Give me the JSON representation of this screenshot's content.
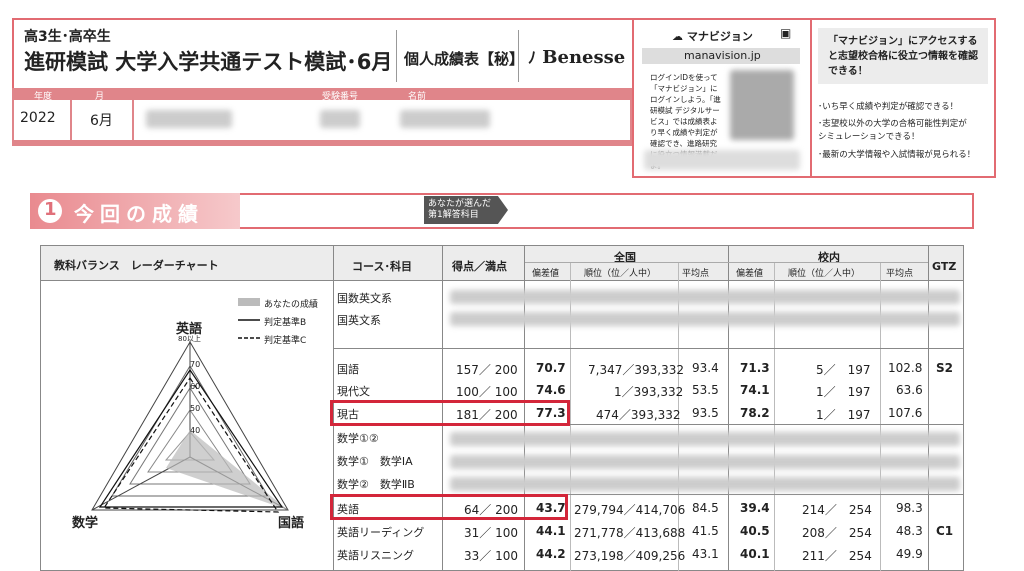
{
  "header": {
    "grade": "高3生･高卒生",
    "exam_title": "進研模試 大学入学共通テスト模試･6月",
    "report_title": "個人成績表【秘】",
    "brand": "Benesse",
    "year_label": "年度",
    "month_label": "月",
    "id_label": "受験番号",
    "name_label": "名前",
    "year": "2022",
    "month": "6月"
  },
  "manavision": {
    "logo": "マナビジョン",
    "url": "manavision.jp",
    "desc": "ログインIDを使って「マナビジョン」にログインしよう。「進研模試 デジタルサービス」では成績表より早く成績や判定が確認でき、進路研究に役立つ情報満載だよ。",
    "promo_title": "「マナビジョン」にアクセスすると志望校合格に役立つ情報を確認できる！",
    "promo_items": [
      "･いち早く成績や判定が確認できる！",
      "･志望校以外の大学の合格可能性判定がシミュレーションできる！",
      "･最新の大学情報や入試情報が見られる！"
    ]
  },
  "section": {
    "number": "1",
    "title": "今回の成績",
    "note": "あなたが選んだ第1解答科目"
  },
  "chart_panel": {
    "title": "教科バランス　レーダーチャート",
    "legend": [
      "あなたの成績",
      "判定基準B",
      "判定基準C"
    ],
    "axis_top": "英語",
    "axis_top_sub": "80以上",
    "axis_left": "数学",
    "axis_right": "国語",
    "ticks": [
      "70",
      "60",
      "50",
      "40"
    ]
  },
  "table": {
    "col_course": "コース･科目",
    "col_score": "得点／満点",
    "col_national": "全国",
    "col_school": "校内",
    "col_gtz": "GTZ",
    "sub_dev": "偏差値",
    "sub_rank": "順位（位／人中）",
    "sub_avg": "平均点",
    "rows": [
      {
        "name": "国数英文系"
      },
      {
        "name": "国英文系"
      },
      {
        "name": "国語",
        "score": "157",
        "max": "200",
        "dev": "70.7",
        "rank": "7,347",
        "total": "393,332",
        "avg": "93.4",
        "sdev": "71.3",
        "srank": "5",
        "stotal": "197",
        "savg": "102.8",
        "gtz": "S2"
      },
      {
        "name": "現代文",
        "score": "100",
        "max": "100",
        "dev": "74.6",
        "rank": "1",
        "total": "393,332",
        "avg": "53.5",
        "sdev": "74.1",
        "srank": "1",
        "stotal": "197",
        "savg": "63.6",
        "gtz": ""
      },
      {
        "name": "現古",
        "score": "181",
        "max": "200",
        "dev": "77.3",
        "rank": "474",
        "total": "393,332",
        "avg": "93.5",
        "sdev": "78.2",
        "srank": "1",
        "stotal": "197",
        "savg": "107.6",
        "gtz": ""
      },
      {
        "name": "数学①②"
      },
      {
        "name": "数学①　数学ⅠA"
      },
      {
        "name": "数学②　数学ⅡB"
      },
      {
        "name": "英語",
        "score": "64",
        "max": "200",
        "dev": "43.7",
        "rank": "279,794",
        "total": "414,706",
        "avg": "84.5",
        "sdev": "39.4",
        "srank": "214",
        "stotal": "254",
        "savg": "98.3",
        "gtz": ""
      },
      {
        "name": "英語リーディング",
        "score": "31",
        "max": "100",
        "dev": "44.1",
        "rank": "271,778",
        "total": "413,688",
        "avg": "41.5",
        "sdev": "40.5",
        "srank": "208",
        "stotal": "254",
        "savg": "48.3",
        "gtz": "C1"
      },
      {
        "name": "英語リスニング",
        "score": "33",
        "max": "100",
        "dev": "44.2",
        "rank": "273,198",
        "total": "409,256",
        "avg": "43.1",
        "sdev": "40.1",
        "srank": "211",
        "stotal": "254",
        "savg": "49.9",
        "gtz": ""
      }
    ]
  }
}
